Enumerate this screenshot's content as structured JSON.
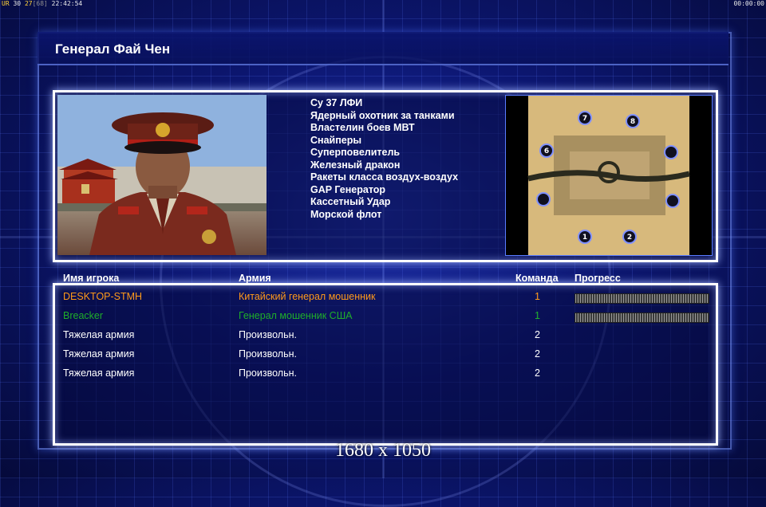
{
  "hud": {
    "left_a": "UR",
    "left_b": "30",
    "left_c": "27",
    "left_d": "[68]",
    "left_time": "22:42:54",
    "right_time": "00:00:00"
  },
  "general": {
    "title": "Генерал Фай Чен"
  },
  "units": [
    "Су 37 ЛФИ",
    "Ядерный охотник за танками",
    "Властелин боев МВТ",
    "Снайперы",
    "Суперповелитель",
    "Железный дракон",
    "Ракеты класса воздух-воздух",
    "GAP Генератор",
    "Кассетный Удар",
    "Морской флот"
  ],
  "map": {
    "spots": [
      "7",
      "8",
      "6",
      "1",
      "2"
    ]
  },
  "table": {
    "headers": {
      "player": "Имя игрока",
      "army": "Армия",
      "team": "Команда",
      "progress": "Прогресс"
    },
    "rows": [
      {
        "player": "DESKTOP-STMH",
        "army": "Китайский генерал мошенник",
        "team": "1",
        "color": "#ff9a1a",
        "progress": 1
      },
      {
        "player": "Breacker",
        "army": "Генерал мошенник США",
        "team": "1",
        "color": "#1fae2a",
        "progress": 1
      },
      {
        "player": "Тяжелая армия",
        "army": "Произвольн.",
        "team": "2",
        "color": "#ffffff"
      },
      {
        "player": "Тяжелая армия",
        "army": "Произвольн.",
        "team": "2",
        "color": "#ffffff"
      },
      {
        "player": "Тяжелая армия",
        "army": "Произвольн.",
        "team": "2",
        "color": "#ffffff"
      }
    ]
  },
  "resolution": "1680 x 1050"
}
